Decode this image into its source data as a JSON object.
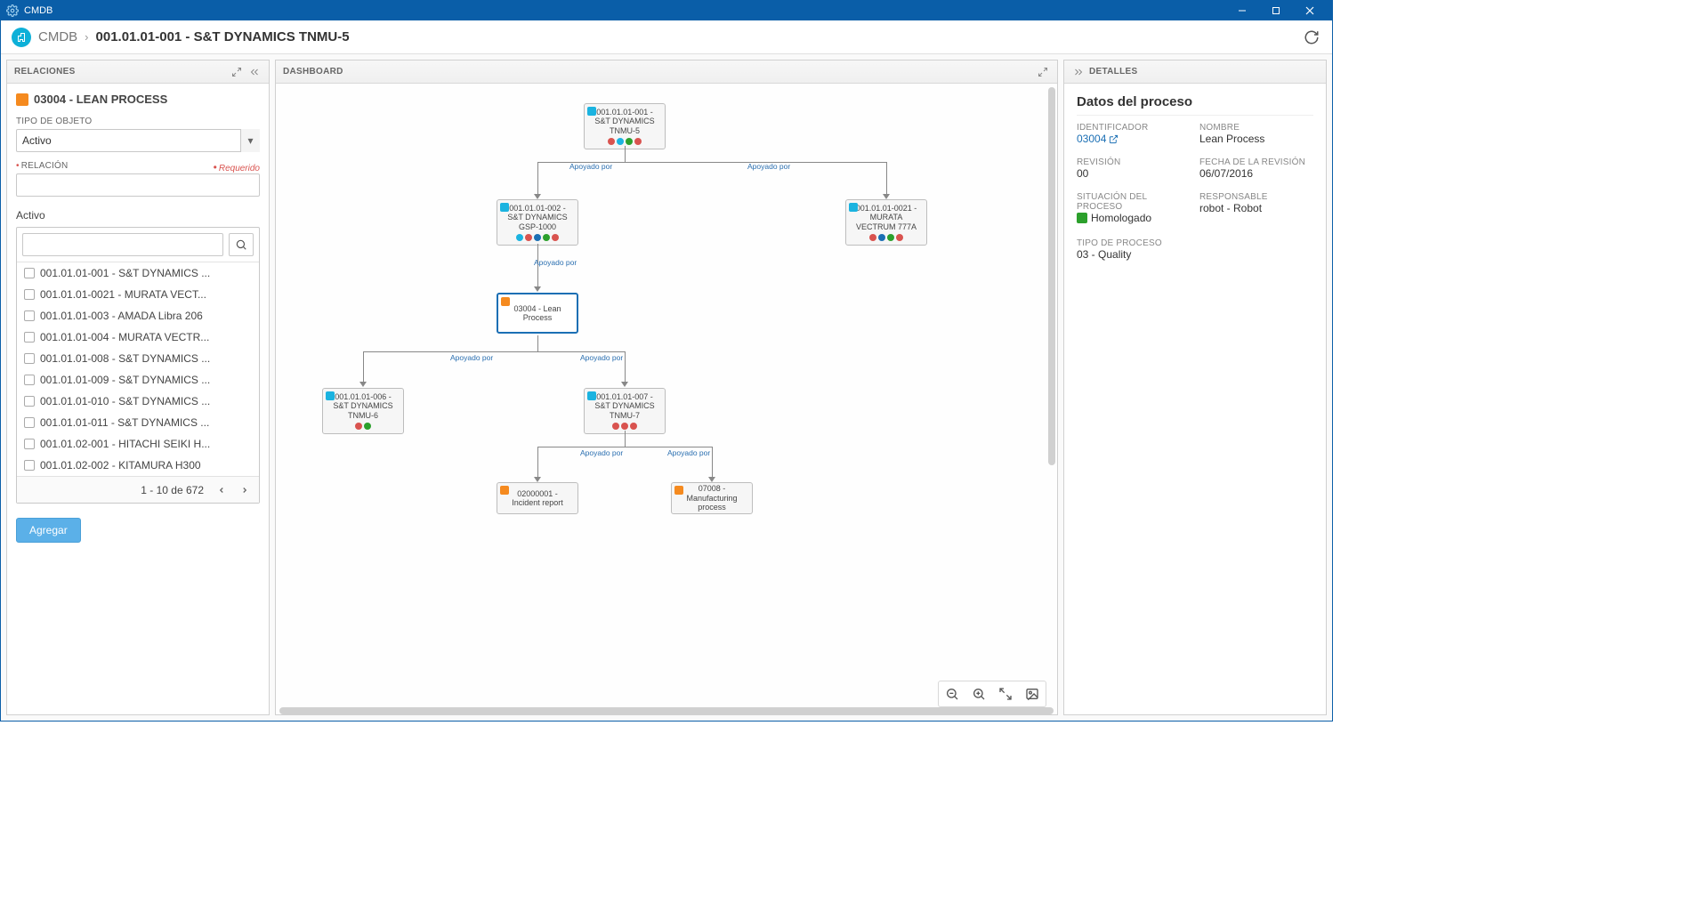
{
  "titlebar": {
    "title": "CMDB"
  },
  "breadcrumb": {
    "root": "CMDB",
    "current": "001.01.01-001 - S&T DYNAMICS TNMU-5"
  },
  "panels": {
    "relaciones": "RELACIONES",
    "dashboard": "DASHBOARD",
    "detalles": "DETALLES"
  },
  "relaciones": {
    "process_title": "03004 - LEAN PROCESS",
    "tipo_label": "TIPO DE OBJETO",
    "tipo_value": "Activo",
    "relacion_label": "RELACIÓN",
    "requerido": "Requerido",
    "activo_header": "Activo",
    "items": [
      {
        "label": "001.01.01-001 - S&T DYNAMICS ..."
      },
      {
        "label": "001.01.01-0021 - MURATA VECT..."
      },
      {
        "label": "001.01.01-003 - AMADA Libra 206"
      },
      {
        "label": "001.01.01-004 - MURATA VECTR..."
      },
      {
        "label": "001.01.01-008 - S&T DYNAMICS ..."
      },
      {
        "label": "001.01.01-009 - S&T DYNAMICS ..."
      },
      {
        "label": "001.01.01-010 - S&T DYNAMICS ..."
      },
      {
        "label": "001.01.01-011 - S&T DYNAMICS ..."
      },
      {
        "label": "001.01.02-001 - HITACHI SEIKI H..."
      },
      {
        "label": "001.01.02-002 - KITAMURA H300"
      }
    ],
    "pager_text": "1 - 10 de 672",
    "agregar": "Agregar"
  },
  "dashboard": {
    "nodes": {
      "n1": "001.01.01-001 - S&T DYNAMICS TNMU-5",
      "n2": "001.01.01-002 - S&T DYNAMICS GSP-1000",
      "n3": "001.01.01-0021 - MURATA VECTRUM 777A",
      "n4": "03004 - Lean Process",
      "n5": "001.01.01-006 - S&T DYNAMICS TNMU-6",
      "n6": "001.01.01-007 - S&T DYNAMICS TNMU-7",
      "n7": "02000001 - Incident report",
      "n8": "07008 - Manufacturing process"
    },
    "edge_label": "Apoyado por"
  },
  "detalles": {
    "section_title": "Datos del proceso",
    "identificador_label": "IDENTIFICADOR",
    "identificador_value": "03004",
    "nombre_label": "NOMBRE",
    "nombre_value": "Lean Process",
    "revision_label": "REVISIÓN",
    "revision_value": "00",
    "fecha_label": "FECHA DE LA REVISIÓN",
    "fecha_value": "06/07/2016",
    "situacion_label": "SITUACIÓN DEL PROCESO",
    "situacion_value": "Homologado",
    "responsable_label": "RESPONSABLE",
    "responsable_value": "robot - Robot",
    "tipo_label": "TIPO DE PROCESO",
    "tipo_value": "03 - Quality"
  }
}
